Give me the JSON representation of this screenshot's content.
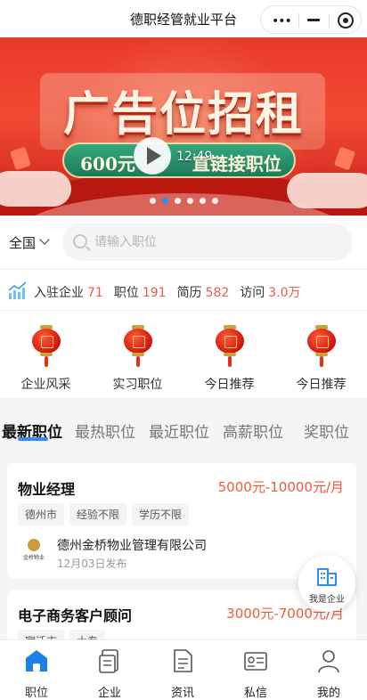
{
  "app": {
    "title": "德职经管就业平台"
  },
  "banner": {
    "headline": "广告位招租",
    "ribbon_left": "600元",
    "ribbon_right": "直链接职位",
    "duration": "12:49"
  },
  "search": {
    "region": "全国",
    "placeholder": "请输入职位"
  },
  "stats": [
    {
      "label": "入驻企业",
      "value": "71"
    },
    {
      "label": "职位",
      "value": "191"
    },
    {
      "label": "简历",
      "value": "582"
    },
    {
      "label": "访问",
      "value": "3.0万"
    }
  ],
  "categories": [
    {
      "label": "企业风采"
    },
    {
      "label": "实习职位"
    },
    {
      "label": "今日推荐"
    },
    {
      "label": "今日推荐"
    }
  ],
  "job_tabs": [
    "最新职位",
    "最热职位",
    "最近职位",
    "高薪职位",
    "奖职位"
  ],
  "jobs": [
    {
      "title": "物业经理",
      "salary": "5000元-10000元/月",
      "tags": [
        "德州市",
        "经验不限",
        "学历不限"
      ],
      "company": "德州金桥物业管理有限公司",
      "company_logo_text": "金桥物业",
      "date": "12月03日发布"
    },
    {
      "title": "电子商务客户顾问",
      "salary": "3000元-7000元/月",
      "tags": [
        "宿迁市",
        "大专"
      ]
    }
  ],
  "fab": {
    "label": "我是企业"
  },
  "nav": [
    {
      "label": "职位",
      "icon": "home-icon"
    },
    {
      "label": "企业",
      "icon": "enterprise-icon"
    },
    {
      "label": "资讯",
      "icon": "news-icon"
    },
    {
      "label": "私信",
      "icon": "message-icon"
    },
    {
      "label": "我的",
      "icon": "user-icon"
    }
  ],
  "colors": {
    "accent": "#2f8cff",
    "salary": "#f05a3a",
    "stat_number": "#f05a4a"
  }
}
